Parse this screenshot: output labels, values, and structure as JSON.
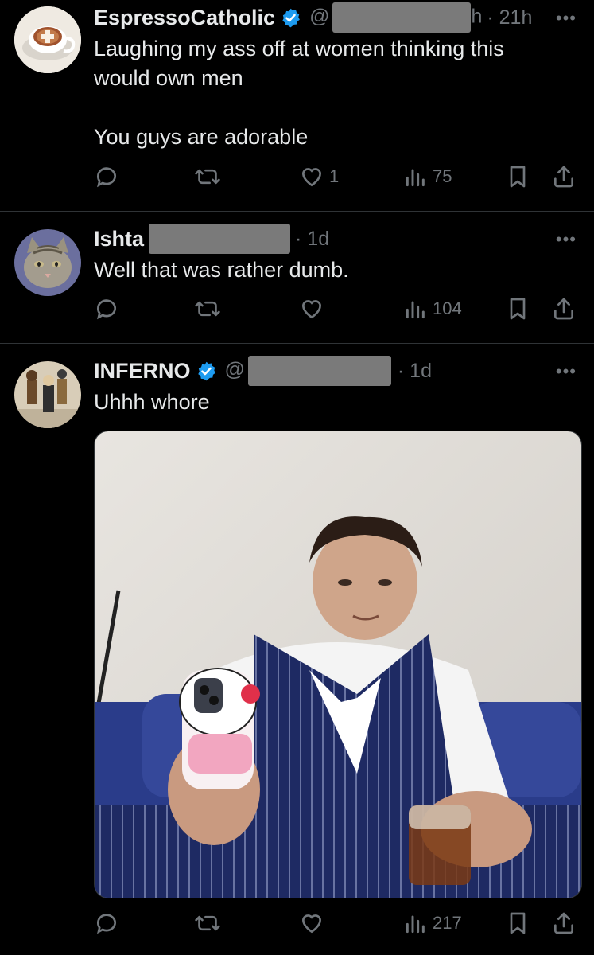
{
  "tweets": [
    {
      "name": "EspressoCatholic",
      "handle_prefix": "@",
      "handle_suffix": "h",
      "time": "· 21h",
      "text": [
        "Laughing my ass off at women thinking this",
        "would own men",
        "",
        "You guys are adorable"
      ],
      "likes": "1",
      "views": "75",
      "avatar_icon": "espresso-cup-icon"
    },
    {
      "name": "Ishta",
      "time": "· 1d",
      "text": [
        "Well that was rather dumb."
      ],
      "likes": "",
      "views": "104",
      "avatar_icon": "cat-avatar"
    },
    {
      "name": "INFERNO",
      "handle_prefix": "@",
      "time": "· 1d",
      "text": [
        "Uhhh whore"
      ],
      "likes": "",
      "views": "217",
      "avatar_icon": "figures-avatar",
      "media": "photo-man-in-pinstripe-vest-holding-hello-kitty-phone-case"
    }
  ],
  "more_label": "•••",
  "colors": {
    "background": "#000000",
    "text": "#e7e9ea",
    "muted": "#71767b",
    "verified": "#1d9bf0",
    "divider": "#2f3336"
  }
}
